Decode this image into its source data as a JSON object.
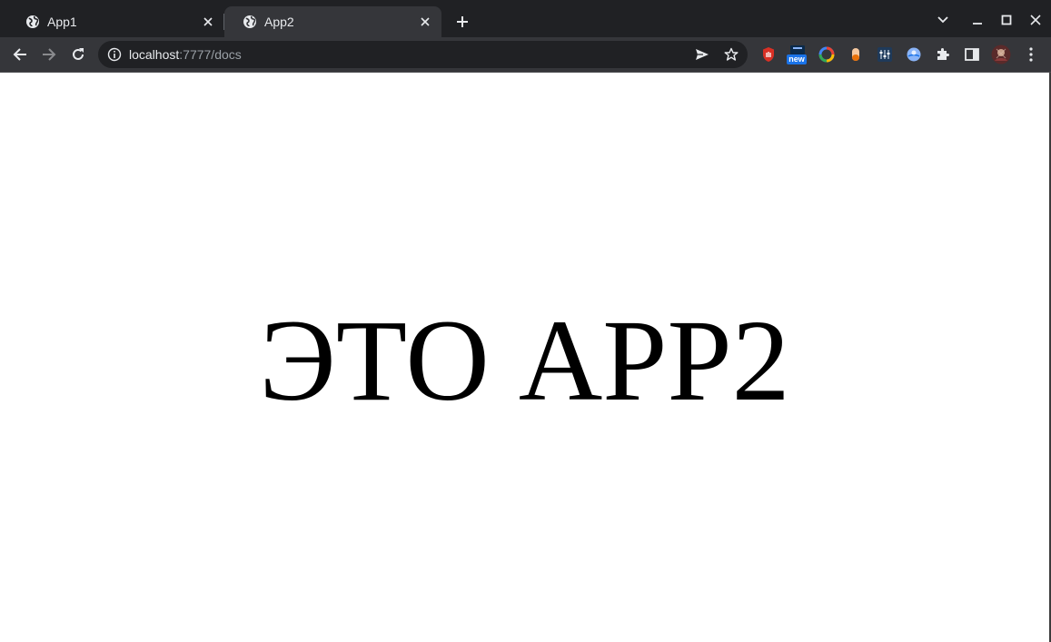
{
  "browser": {
    "tabs": [
      {
        "title": "App1",
        "favicon": "globe-icon",
        "active": false
      },
      {
        "title": "App2",
        "favicon": "globe-icon",
        "active": true
      }
    ],
    "address_bar": {
      "host": "localhost",
      "path": ":7777/docs"
    },
    "extensions": [
      "hand-extension-icon",
      "new-badge-extension-icon",
      "color-ring-extension-icon",
      "capsule-extension-icon",
      "equalizer-extension-icon",
      "globe-bubble-extension-icon",
      "puzzle-extensions-icon",
      "side-panel-icon",
      "profile-avatar"
    ],
    "extension_badge_text": "new",
    "colors": {
      "frame": "#202124",
      "toolbar": "#35363a",
      "text": "#e8eaed",
      "url_path": "#9aa0a6"
    }
  },
  "page": {
    "heading": "ЭТО APP2"
  }
}
